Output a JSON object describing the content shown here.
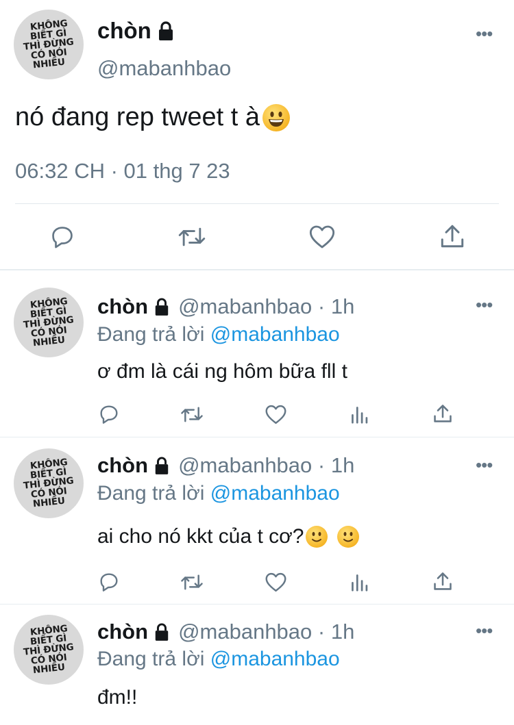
{
  "main_tweet": {
    "display_name": "chòn",
    "handle": "@mabanhbao",
    "text": "nó đang rep tweet t à",
    "timestamp": "06:32 CH · 01 thg 7 23",
    "avatar_text": [
      "KHÔNG",
      "BIẾT GÌ",
      "THÌ ĐỪNG",
      "CÓ NÓI",
      "NHIỀU"
    ]
  },
  "replies": [
    {
      "display_name": "chòn",
      "handle_time": "@mabanhbao · 1h",
      "replying_prefix": "Đang trả lời",
      "replying_mention": "@mabanhbao",
      "text": "ơ đm là cái ng hôm bữa fll t"
    },
    {
      "display_name": "chòn",
      "handle_time": "@mabanhbao · 1h",
      "replying_prefix": "Đang trả lời",
      "replying_mention": "@mabanhbao",
      "text": "ai cho nó kkt của t cơ?"
    },
    {
      "display_name": "chòn",
      "handle_time": "@mabanhbao · 1h",
      "replying_prefix": "Đang trả lời",
      "replying_mention": "@mabanhbao",
      "text": "đm!!"
    }
  ],
  "more_glyph": "•••",
  "icons": [
    "lock-icon",
    "more-icon",
    "reply-icon",
    "retweet-icon",
    "like-icon",
    "share-icon",
    "analytics-icon",
    "grinning-emoji",
    "slight-smile-emoji"
  ],
  "colors": {
    "text": "#14171a",
    "secondary": "#657786",
    "link": "#1b95e0",
    "divider": "#e1e8ed",
    "emoji": "#f6b628"
  }
}
